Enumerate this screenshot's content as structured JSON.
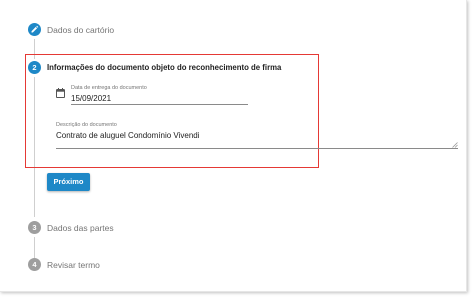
{
  "steps": [
    {
      "number": "",
      "label": "Dados do cartório",
      "state": "done"
    },
    {
      "number": "2",
      "label": "Informações do documento objeto do reconhecimento de firma",
      "state": "active"
    },
    {
      "number": "3",
      "label": "Dados das partes",
      "state": "pending"
    },
    {
      "number": "4",
      "label": "Revisar termo",
      "state": "pending"
    }
  ],
  "form": {
    "date_label": "Data de entrega do documento",
    "date_value": "15/09/2021",
    "desc_label": "Descrição do documento",
    "desc_value": "Contrato de aluguel Condomínio Vivendi"
  },
  "next_button": "Próximo",
  "colors": {
    "accent": "#1e88c7",
    "highlight": "#e53935",
    "pending": "#9e9e9e"
  },
  "icons": {
    "step1": "pencil-icon",
    "date": "calendar-icon"
  }
}
